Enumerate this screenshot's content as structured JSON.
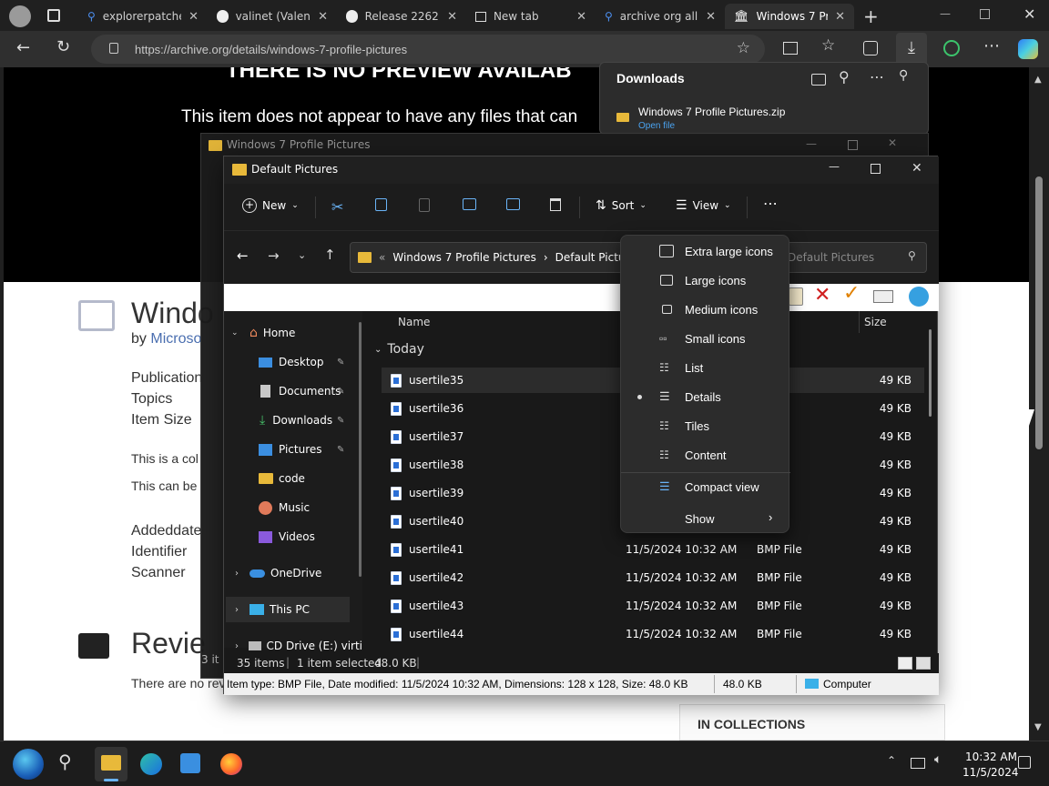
{
  "browser": {
    "tabs": [
      {
        "title": "explorerpatcher",
        "icon": "search-icon"
      },
      {
        "title": "valinet (Valentin)",
        "icon": "github-icon"
      },
      {
        "title": "Release 22621",
        "icon": "github-icon"
      },
      {
        "title": "New tab",
        "icon": "newtab-icon"
      },
      {
        "title": "archive org all",
        "icon": "search-icon"
      },
      {
        "title": "Windows 7 Profile",
        "icon": "archive-icon"
      }
    ],
    "url": "https://archive.org/details/windows-7-profile-pictures"
  },
  "downloads": {
    "title": "Downloads",
    "file": "Windows 7 Profile Pictures.zip",
    "action": "Open file"
  },
  "page": {
    "banner_title": "THERE IS NO PREVIEW AVAILAB",
    "banner_sub": "This item does not appear to have any files that can",
    "item_title": "Windo",
    "by": "by",
    "by_link": "Microso",
    "meta_labels": [
      "Publication",
      "Topics",
      "Item Size"
    ],
    "desc1": "This is a col",
    "desc2": "This can be",
    "meta2": [
      "Addeddate",
      "Identifier",
      "Scanner"
    ],
    "reviews": "Revie",
    "no_reviews": "There are no rev",
    "collections": "IN COLLECTIONS"
  },
  "back_window": {
    "title": "Windows 7 Profile Pictures",
    "status": "3 it"
  },
  "explorer": {
    "title": "Default Pictures",
    "toolbar": {
      "new": "New",
      "sort": "Sort",
      "view": "View"
    },
    "breadcrumb": [
      "Windows 7 Profile Pictures",
      "Default Pictures"
    ],
    "search_placeholder": "Default Pictures",
    "nav": [
      {
        "label": "Home",
        "icon": "home-icon"
      },
      {
        "label": "Desktop",
        "icon": "desktop-icon"
      },
      {
        "label": "Documents",
        "icon": "documents-icon"
      },
      {
        "label": "Downloads",
        "icon": "downloads-icon"
      },
      {
        "label": "Pictures",
        "icon": "pictures-icon"
      },
      {
        "label": "code",
        "icon": "folder-icon"
      },
      {
        "label": "Music",
        "icon": "music-icon"
      },
      {
        "label": "Videos",
        "icon": "videos-icon"
      },
      {
        "label": "OneDrive",
        "icon": "onedrive-icon"
      },
      {
        "label": "This PC",
        "icon": "pc-icon"
      },
      {
        "label": "CD Drive (E:) virti",
        "icon": "cd-icon"
      }
    ],
    "columns": {
      "name": "Name",
      "size": "Size"
    },
    "group": "Today",
    "rows": [
      {
        "name": "usertile35",
        "date": "",
        "type": "e",
        "size": "49 KB"
      },
      {
        "name": "usertile36",
        "date": "",
        "type": "e",
        "size": "49 KB"
      },
      {
        "name": "usertile37",
        "date": "",
        "type": "e",
        "size": "49 KB"
      },
      {
        "name": "usertile38",
        "date": "",
        "type": "e",
        "size": "49 KB"
      },
      {
        "name": "usertile39",
        "date": "",
        "type": "e",
        "size": "49 KB"
      },
      {
        "name": "usertile40",
        "date": "",
        "type": "e",
        "size": "49 KB"
      },
      {
        "name": "usertile41",
        "date": "11/5/2024 10:32 AM",
        "type": "BMP File",
        "size": "49 KB"
      },
      {
        "name": "usertile42",
        "date": "11/5/2024 10:32 AM",
        "type": "BMP File",
        "size": "49 KB"
      },
      {
        "name": "usertile43",
        "date": "11/5/2024 10:32 AM",
        "type": "BMP File",
        "size": "49 KB"
      },
      {
        "name": "usertile44",
        "date": "11/5/2024 10:32 AM",
        "type": "BMP File",
        "size": "49 KB"
      }
    ],
    "status": {
      "items": "35 items",
      "selected": "1 item selected",
      "size": "48.0 KB"
    },
    "detail": {
      "text": "Item type: BMP File, Date modified: 11/5/2024 10:32 AM, Dimensions: 128 x 128, Size: 48.0 KB",
      "size": "48.0 KB",
      "location": "Computer"
    }
  },
  "view_menu": {
    "items": [
      "Extra large icons",
      "Large icons",
      "Medium icons",
      "Small icons",
      "List",
      "Details",
      "Tiles",
      "Content"
    ],
    "selected": "Details",
    "compact": "Compact view",
    "show": "Show"
  },
  "taskbar": {
    "time": "10:32 AM",
    "date": "11/5/2024"
  }
}
